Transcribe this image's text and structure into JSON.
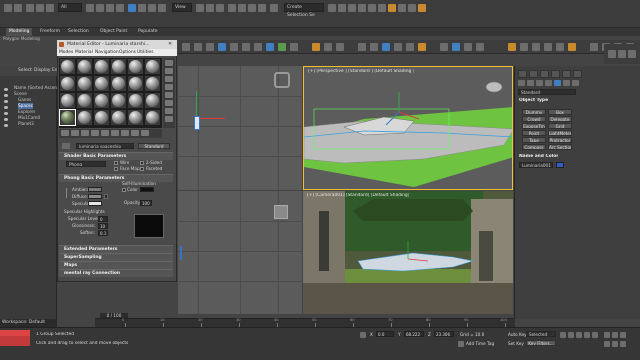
{
  "topbar": {
    "selection_filter": "All",
    "view_dropdown": "View",
    "create_selection_set": "Create Selection Se"
  },
  "ribbon": {
    "tabs": [
      "Modeling",
      "Freeform",
      "Selection",
      "Object Paint",
      "Populate"
    ],
    "active_tab": "Modeling",
    "sub": "Polygon Modeling"
  },
  "explorer": {
    "tabs": [
      "Select",
      "Display",
      "Edit"
    ],
    "rows": [
      "Name (Sorted Ascen",
      "Scene",
      "Ganes",
      "Spacec",
      "Explorer",
      "Mix1Cam0",
      "Planet3"
    ]
  },
  "material_editor": {
    "title": "Material Editor - Luminaria starshi...",
    "menu": [
      "Modes",
      "Material",
      "Navigation",
      "Options",
      "Utilities"
    ],
    "material_name": "luminaria spaceship",
    "material_type": "Standard",
    "shader_section": "Shader Basic Parameters",
    "shader": "Phong",
    "shader_options": [
      "Wire",
      "2-Sided",
      "Face Map",
      "Faceted"
    ],
    "phong_section": "Phong Basic Parameters",
    "self_illumination": "Self-Illumination",
    "color_label": "Color",
    "color_value": "0",
    "ambient": "Ambient:",
    "diffuse": "Diffuse:",
    "specular": "Specular:",
    "opacity_label": "Opacity:",
    "opacity_value": "100",
    "specular_highlights": "Specular Highlights",
    "specular_level_label": "Specular Level:",
    "specular_level": "0",
    "glossiness_label": "Glossiness:",
    "glossiness": "10",
    "soften_label": "Soften:",
    "soften": "0.1",
    "extra_sections": [
      "Extended Parameters",
      "SuperSampling",
      "Maps",
      "mental ray Connection"
    ]
  },
  "viewports": {
    "perspective_label": "[+] [Perspective ] [Standard ] [Default Shading ]",
    "camera_label": "[+] [Camera001] [Standard] [Default Shading]"
  },
  "command_panel": {
    "dropdown": "Standard",
    "object_type": "Object Type",
    "buttons": [
      "Dummy",
      "Box",
      "Crowd",
      "Delegate",
      "ExposeTm",
      "Grid",
      "Point",
      "LightMeter",
      "Tape",
      "Protractor",
      "Compass",
      "Arc Section"
    ],
    "name_color": "Name and Color",
    "object_name": "Luminaria001"
  },
  "timeline": {
    "frame_display": "0 / 100",
    "ticks": [
      "0",
      "10",
      "20",
      "30",
      "40",
      "50",
      "60",
      "70",
      "80",
      "90",
      "100"
    ]
  },
  "status": {
    "workspace": "Workspace: Default",
    "group_selected": "1 Group Selected",
    "prompt": "Click and drag to select and move objects",
    "x_value": "0.0",
    "y_value": "68.222",
    "z_value": "23.306",
    "grid": "Grid = 10.0",
    "add_time_tag": "Add Time Tag",
    "auto_key": "Auto Key",
    "selected": "Selected",
    "set_key": "Set Key",
    "key_filters": "Key Filters..."
  }
}
